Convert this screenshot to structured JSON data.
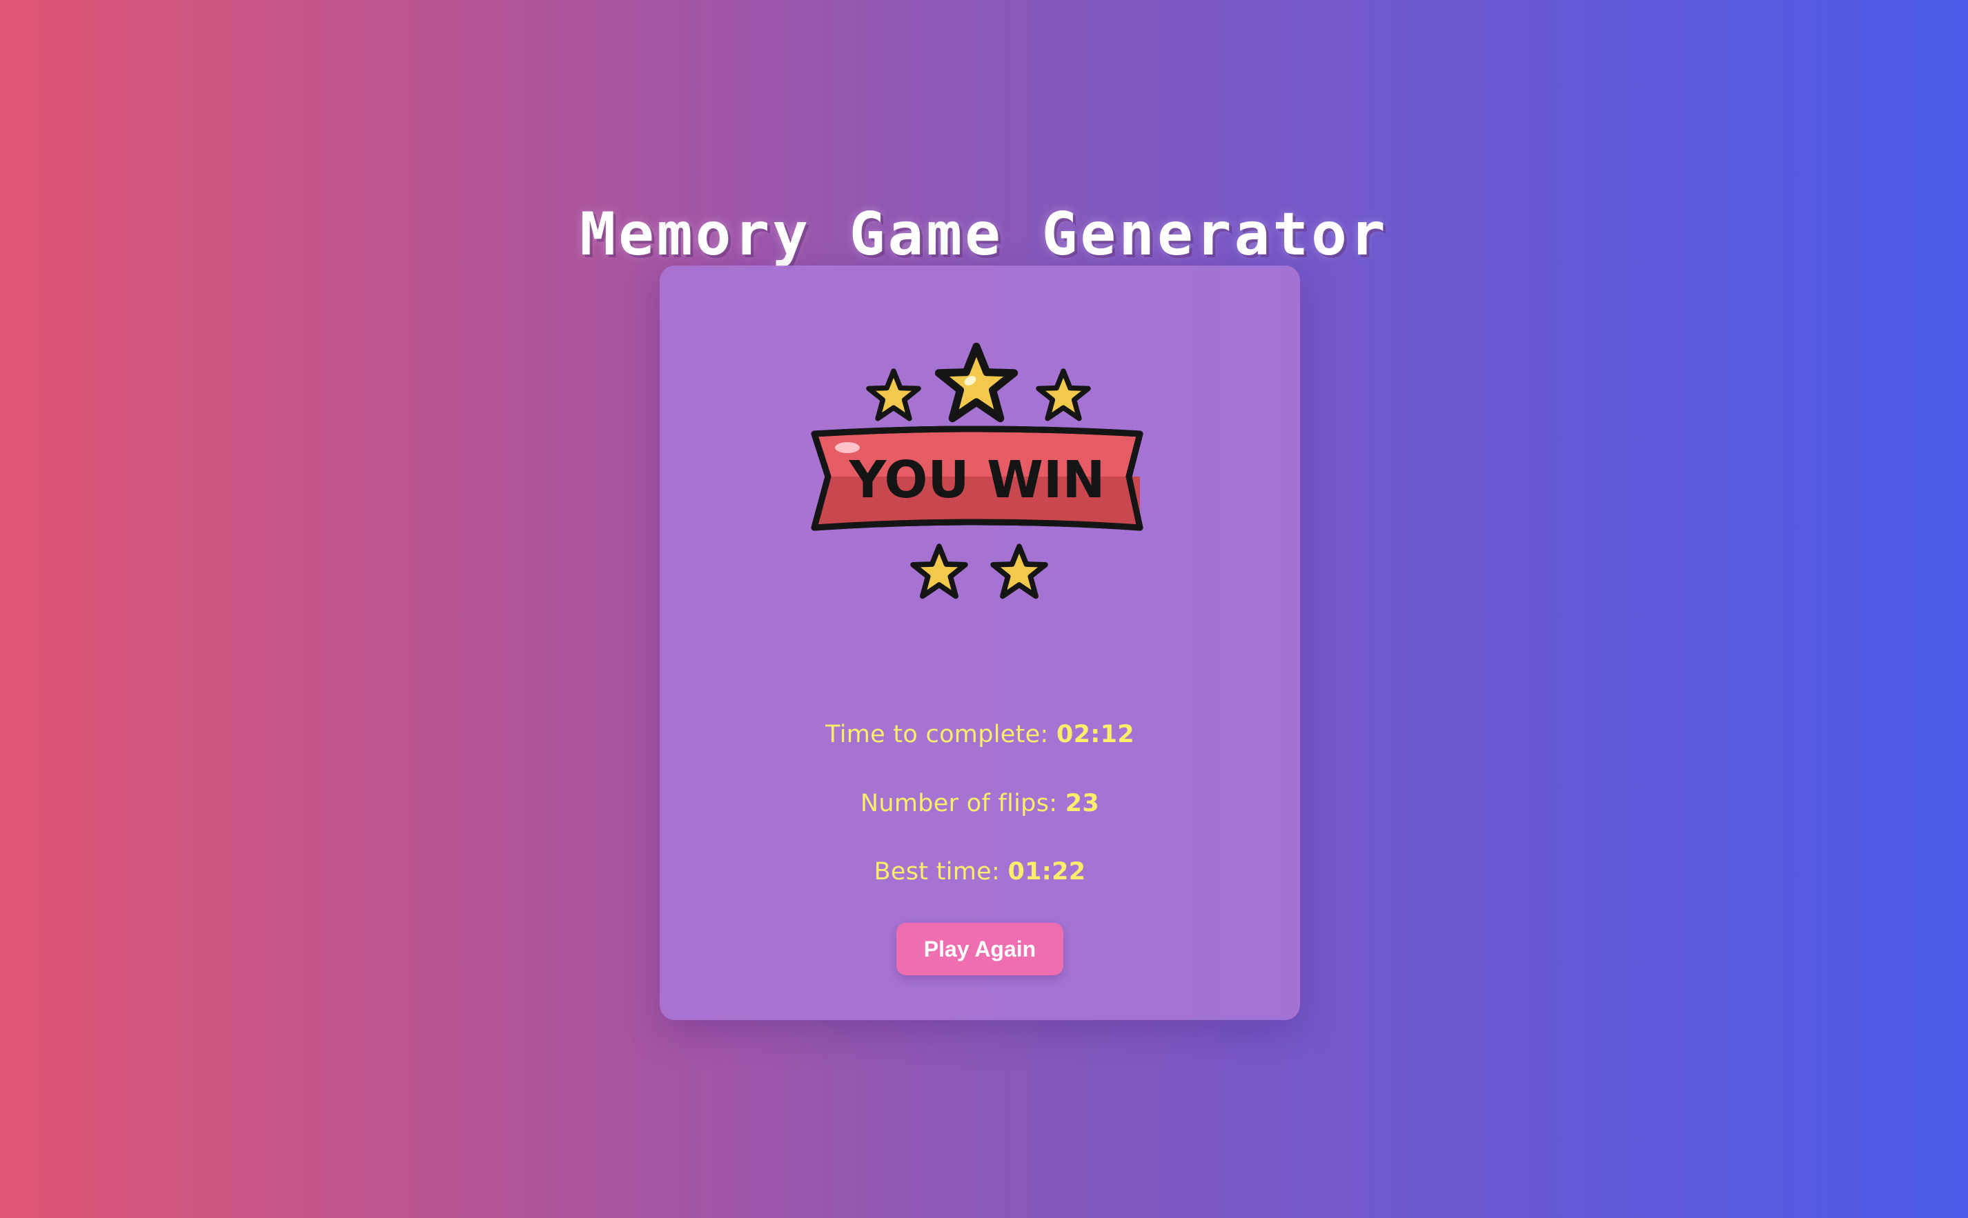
{
  "header": {
    "title": "Memory Game Generator"
  },
  "result": {
    "badge_text": "YOU WIN",
    "stats": [
      {
        "label": "Time to complete:",
        "value": "02:12"
      },
      {
        "label": "Number of flips:",
        "value": "23"
      },
      {
        "label": "Best time:",
        "value": "01:22"
      }
    ],
    "play_again_label": "Play Again"
  },
  "colors": {
    "stat_text": "#f8ef6a",
    "button": "#ee6eb0",
    "ribbon": "#e65c65",
    "star": "#f2c94c"
  }
}
